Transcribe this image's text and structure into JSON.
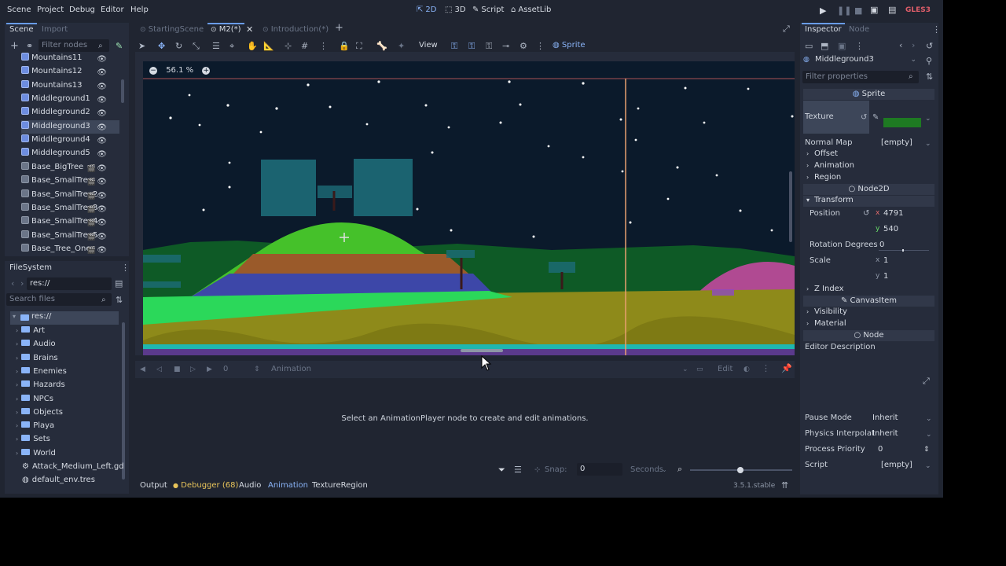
{
  "menubar": {
    "items": [
      "Scene",
      "Project",
      "Debug",
      "Editor",
      "Help"
    ],
    "workspaces": [
      "2D",
      "3D",
      "Script",
      "AssetLib"
    ],
    "renderer": "GLES3"
  },
  "scene_dock": {
    "tabs": [
      "Scene",
      "Import"
    ],
    "filter_placeholder": "Filter nodes",
    "nodes": [
      {
        "label": "Mountains11",
        "type": "sprite"
      },
      {
        "label": "Mountains12",
        "type": "sprite"
      },
      {
        "label": "Mountains13",
        "type": "sprite"
      },
      {
        "label": "Middleground1",
        "type": "sprite"
      },
      {
        "label": "Middleground2",
        "type": "sprite"
      },
      {
        "label": "Middleground3",
        "type": "sprite",
        "selected": true
      },
      {
        "label": "Middleground4",
        "type": "sprite"
      },
      {
        "label": "Middleground5",
        "type": "sprite"
      },
      {
        "label": "Base_BigTree",
        "type": "instance"
      },
      {
        "label": "Base_SmallTree",
        "type": "instance"
      },
      {
        "label": "Base_SmallTree2",
        "type": "instance"
      },
      {
        "label": "Base_SmallTree3",
        "type": "instance"
      },
      {
        "label": "Base_SmallTree4",
        "type": "instance"
      },
      {
        "label": "Base_SmallTree5",
        "type": "instance"
      },
      {
        "label": "Base_Tree_One",
        "type": "instance"
      }
    ]
  },
  "filesystem": {
    "title": "FileSystem",
    "path": "res://",
    "search_placeholder": "Search files",
    "root": "res://",
    "items": [
      {
        "label": "Art",
        "kind": "folder"
      },
      {
        "label": "Audio",
        "kind": "folder"
      },
      {
        "label": "Brains",
        "kind": "folder"
      },
      {
        "label": "Enemies",
        "kind": "folder"
      },
      {
        "label": "Hazards",
        "kind": "folder"
      },
      {
        "label": "NPCs",
        "kind": "folder"
      },
      {
        "label": "Objects",
        "kind": "folder"
      },
      {
        "label": "Playa",
        "kind": "folder"
      },
      {
        "label": "Sets",
        "kind": "folder"
      },
      {
        "label": "World",
        "kind": "folder"
      },
      {
        "label": "Attack_Medium_Left.gd",
        "kind": "script"
      },
      {
        "label": "default_env.tres",
        "kind": "resource"
      }
    ]
  },
  "scene_tabs": [
    "StartingScene",
    "M2(*)",
    "Introduction(*)"
  ],
  "viewport": {
    "zoom": "56.1 %",
    "view_menu": "View",
    "sprite_menu": "Sprite"
  },
  "animation_panel": {
    "time": "0",
    "label": "Animation",
    "edit": "Edit",
    "message": "Select an AnimationPlayer node to create and edit animations.",
    "snap_label": "Snap:",
    "snap_value": "0",
    "snap_unit": "Seconds"
  },
  "bottom_tabs": {
    "output": "Output",
    "debugger": "Debugger (68)",
    "audio": "Audio",
    "animation": "Animation",
    "texture_region": "TextureRegion",
    "version": "3.5.1.stable"
  },
  "inspector": {
    "tabs": [
      "Inspector",
      "Node"
    ],
    "object": "Middleground3",
    "filter_placeholder": "Filter properties",
    "sprite_header": "Sprite",
    "texture_label": "Texture",
    "normal_map_label": "Normal Map",
    "normal_map_value": "[empty]",
    "sections1": [
      "Offset",
      "Animation",
      "Region"
    ],
    "node2d_header": "Node2D",
    "transform_label": "Transform",
    "position_label": "Position",
    "position_x": "4791",
    "position_y": "540",
    "rotation_label": "Rotation Degrees",
    "rotation_value": "0",
    "scale_label": "Scale",
    "scale_x": "1",
    "scale_y": "1",
    "z_index": "Z Index",
    "canvasitem_header": "CanvasItem",
    "visibility": "Visibility",
    "material": "Material",
    "node_header": "Node",
    "editor_description": "Editor Description",
    "pause_mode_label": "Pause Mode",
    "pause_mode_value": "Inherit",
    "physics_label": "Physics Interpolat",
    "physics_value": "Inherit",
    "priority_label": "Process Priority",
    "priority_value": "0",
    "script_label": "Script",
    "script_value": "[empty]"
  }
}
